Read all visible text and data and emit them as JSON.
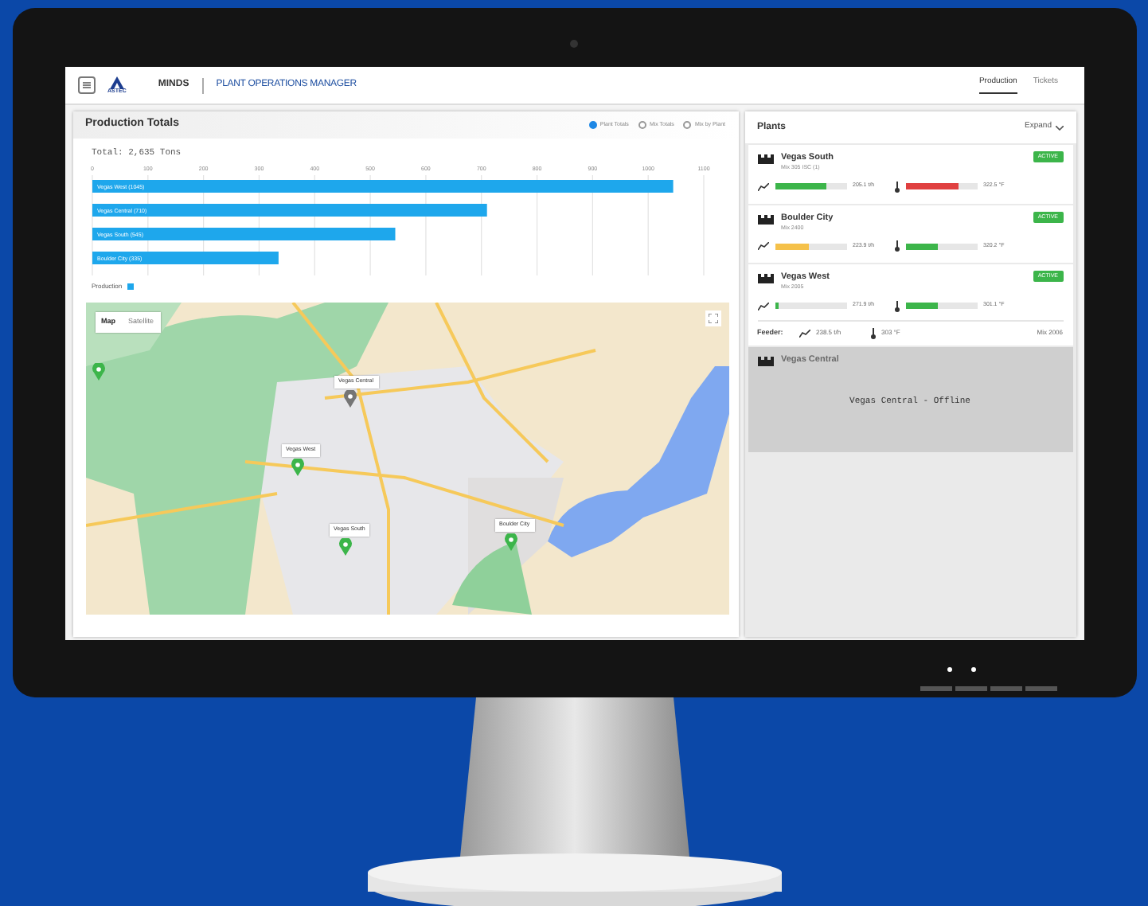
{
  "header": {
    "app": "MINDS",
    "logo": "ASTEC",
    "title": "PLANT OPERATIONS MANAGER",
    "tabs": [
      {
        "label": "Production",
        "selected": true
      },
      {
        "label": "Tickets",
        "selected": false
      }
    ]
  },
  "production": {
    "title": "Production Totals",
    "options": [
      {
        "label": "Plant Totals",
        "selected": true
      },
      {
        "label": "Mix Totals",
        "selected": false
      },
      {
        "label": "Mix by Plant",
        "selected": false
      }
    ],
    "total": "Total: 2,635 Tons",
    "chart_data": {
      "type": "bar",
      "orientation": "horizontal",
      "categories": [
        "Vegas West (1045)",
        "Vegas Central (710)",
        "Vegas South (545)",
        "Boulder City (335)"
      ],
      "series": [
        {
          "name": "Production",
          "color": "#1ea7ec",
          "values": [
            1045,
            710,
            545,
            335
          ]
        }
      ],
      "xlim": [
        0,
        1100
      ],
      "xticks": [
        0,
        100,
        200,
        300,
        400,
        500,
        600,
        700,
        800,
        900,
        1000,
        1100
      ],
      "grid": true
    },
    "map": {
      "buttons": [
        {
          "label": "Map",
          "selected": true
        },
        {
          "label": "Satellite",
          "selected": false
        }
      ],
      "pins": [
        {
          "label": "Vegas Central",
          "color": "#757575"
        },
        {
          "label": "Vegas West",
          "color": "#3cb54a"
        },
        {
          "label": "Vegas South",
          "color": "#3cb54a"
        },
        {
          "label": "Boulder City",
          "color": "#3cb54a"
        },
        {
          "color": "#3cb54a"
        }
      ]
    }
  },
  "plants": {
    "title": "Plants",
    "expand": "Expand",
    "items": [
      {
        "name": "Vegas South",
        "subtitle": "Mix 305 ISC (1)",
        "status": "ACTIVE",
        "online": true,
        "metrics": [
          {
            "kind": "production",
            "level": 0.72,
            "color": "#3cb54a",
            "reading": "205.1 t/h"
          },
          {
            "kind": "temperature",
            "level": 0.75,
            "color": "#e04040",
            "reading": "322.5 °F"
          }
        ]
      },
      {
        "name": "Boulder City",
        "subtitle": "Mix 2400",
        "status": "ACTIVE",
        "online": true,
        "metrics": [
          {
            "kind": "production",
            "level": 0.48,
            "color": "#f5c14a",
            "reading": "223.9 t/h"
          },
          {
            "kind": "temperature",
            "level": 0.45,
            "color": "#3cb54a",
            "reading": "320.2 °F"
          }
        ]
      },
      {
        "name": "Vegas West",
        "subtitle": "Mix 2005",
        "status": "ACTIVE",
        "online": true,
        "metrics": [
          {
            "kind": "production",
            "level": 0.05,
            "color": "#3cb54a",
            "reading": "271.9 t/h"
          },
          {
            "kind": "temperature",
            "level": 0.45,
            "color": "#3cb54a",
            "reading": "301.1 °F"
          }
        ],
        "feeder": {
          "label": "Feeder:",
          "rate": "238.5 t/h",
          "temp": "303 °F",
          "mix": "Mix 2006"
        }
      },
      {
        "name": "Vegas Central",
        "online": false,
        "message": "Vegas Central - Offline"
      }
    ]
  }
}
